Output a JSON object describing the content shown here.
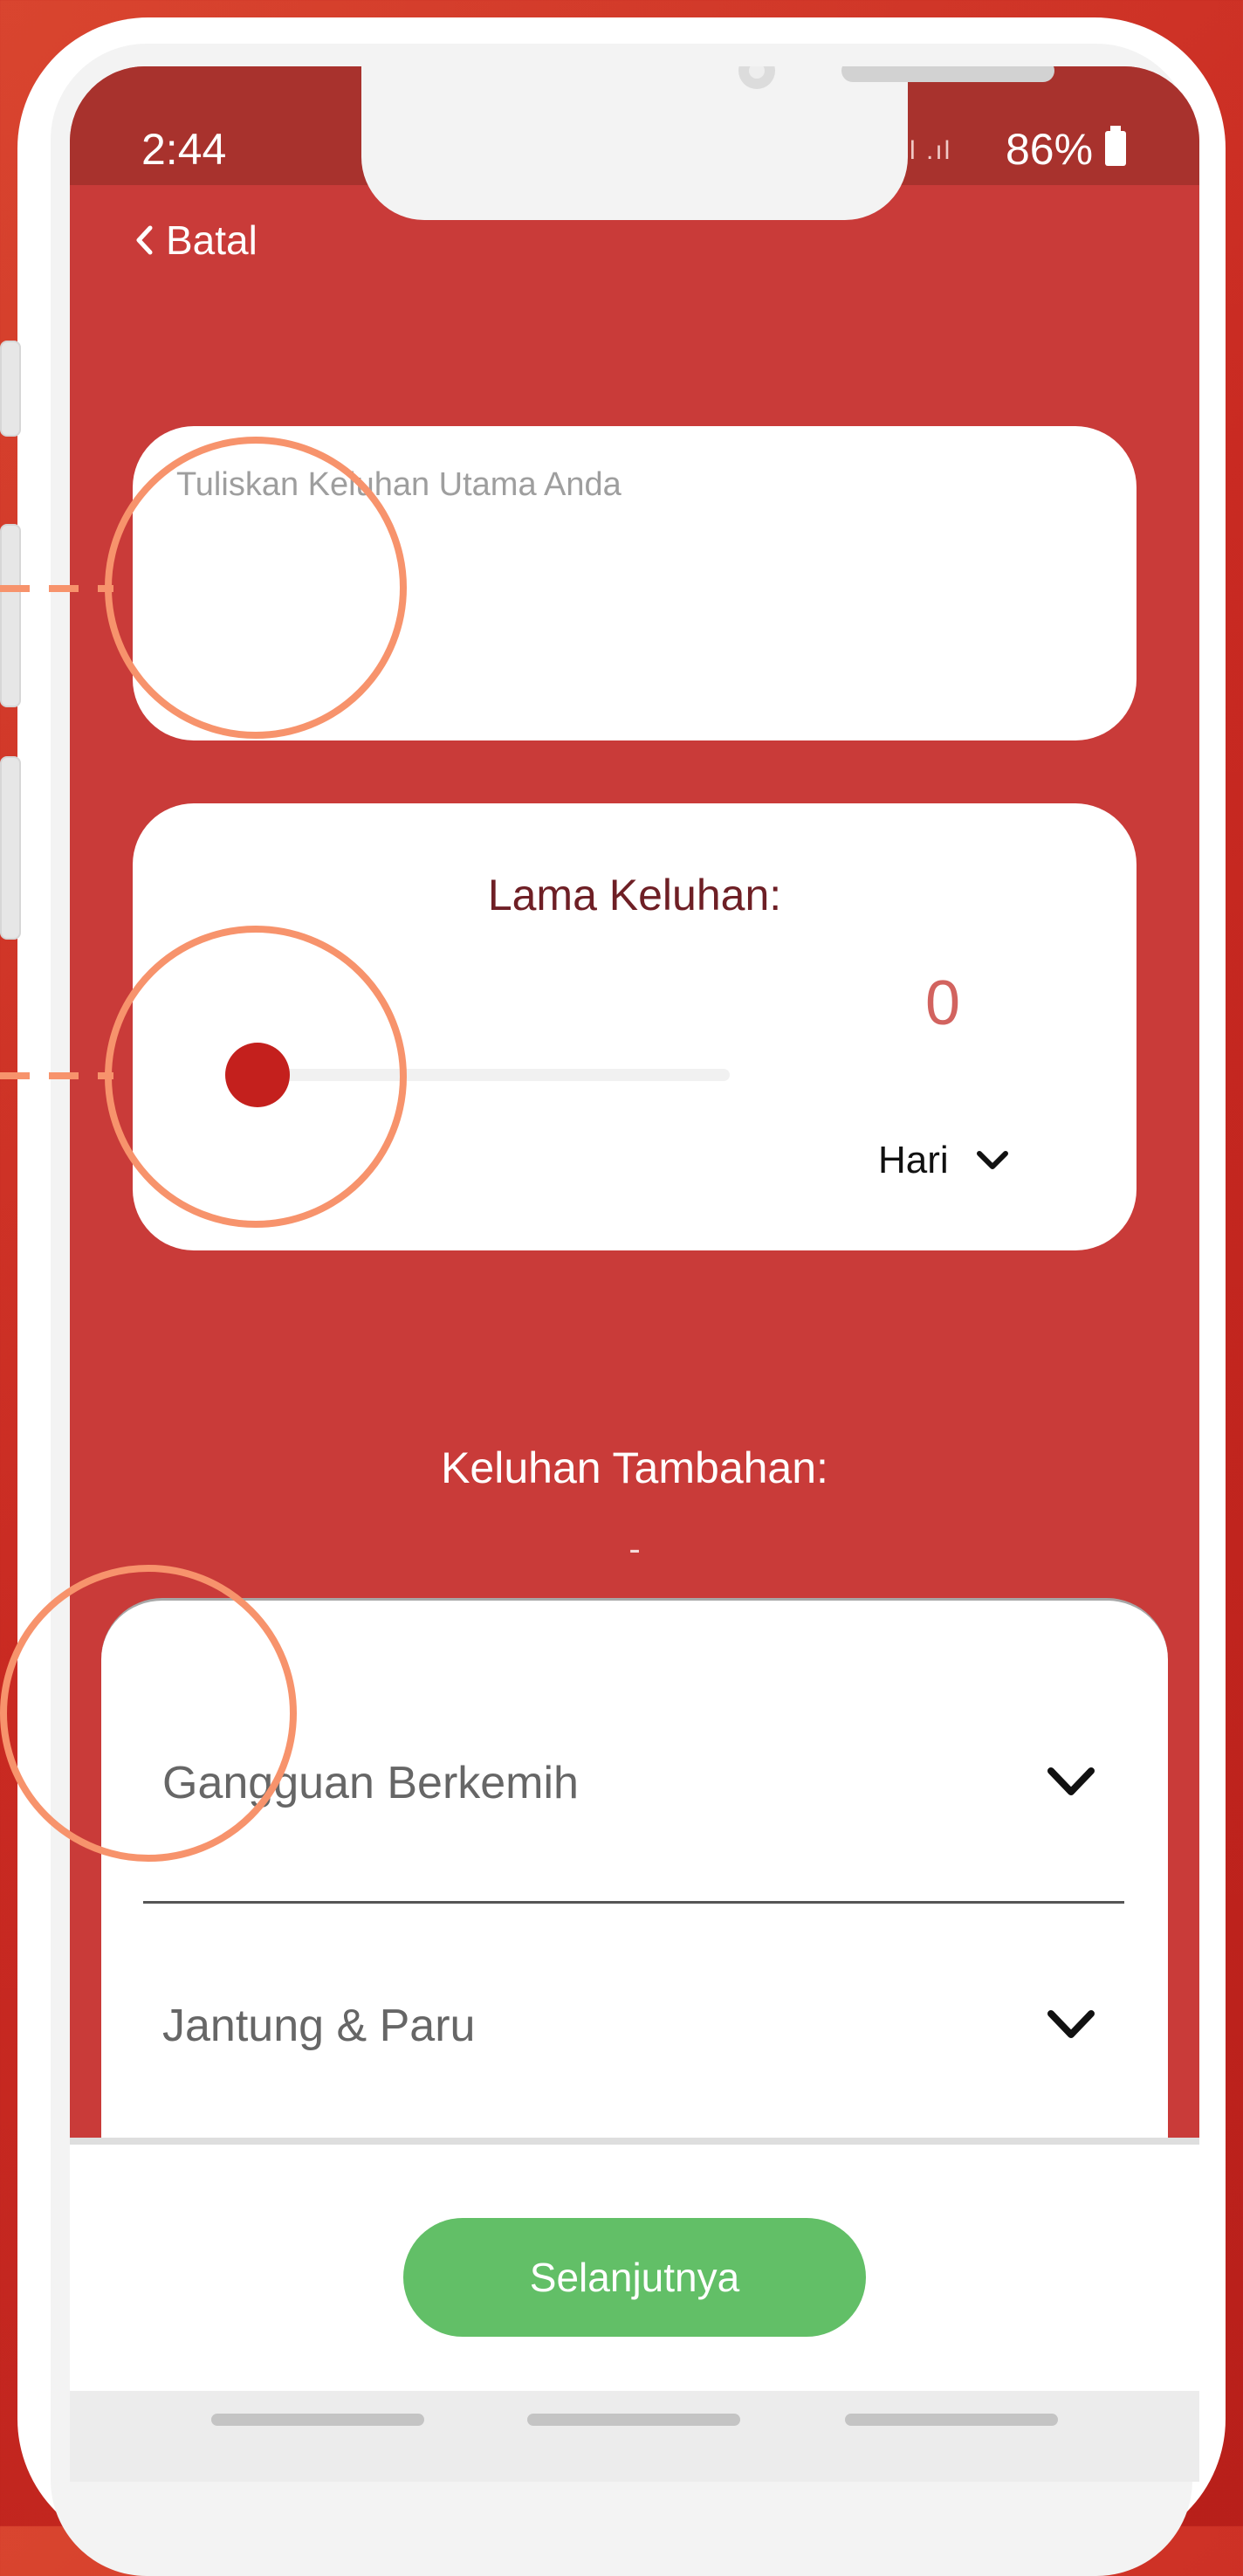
{
  "status_bar": {
    "time": "2:44",
    "signal": "·ᵼᵻ.ıl .ıl",
    "battery": "86%"
  },
  "nav": {
    "back_label": "Batal"
  },
  "complaint": {
    "placeholder": "Tuliskan Keluhan Utama Anda",
    "value": ""
  },
  "duration": {
    "title": "Lama Keluhan:",
    "value": "0",
    "slider_fraction": 0,
    "unit": "Hari"
  },
  "extra": {
    "title": "Keluhan Tambahan:",
    "value": "-"
  },
  "accordion": {
    "items": [
      {
        "label": "Gangguan Berkemih"
      },
      {
        "label": "Jantung & Paru"
      }
    ]
  },
  "footer": {
    "next_label": "Selanjutnya"
  },
  "colors": {
    "background": "#c93b39",
    "status_bar": "#a8322d",
    "slider_thumb": "#c4201d",
    "duration_value": "#d2635f",
    "next_button": "#62bf67",
    "annotation": "#f7936c"
  }
}
